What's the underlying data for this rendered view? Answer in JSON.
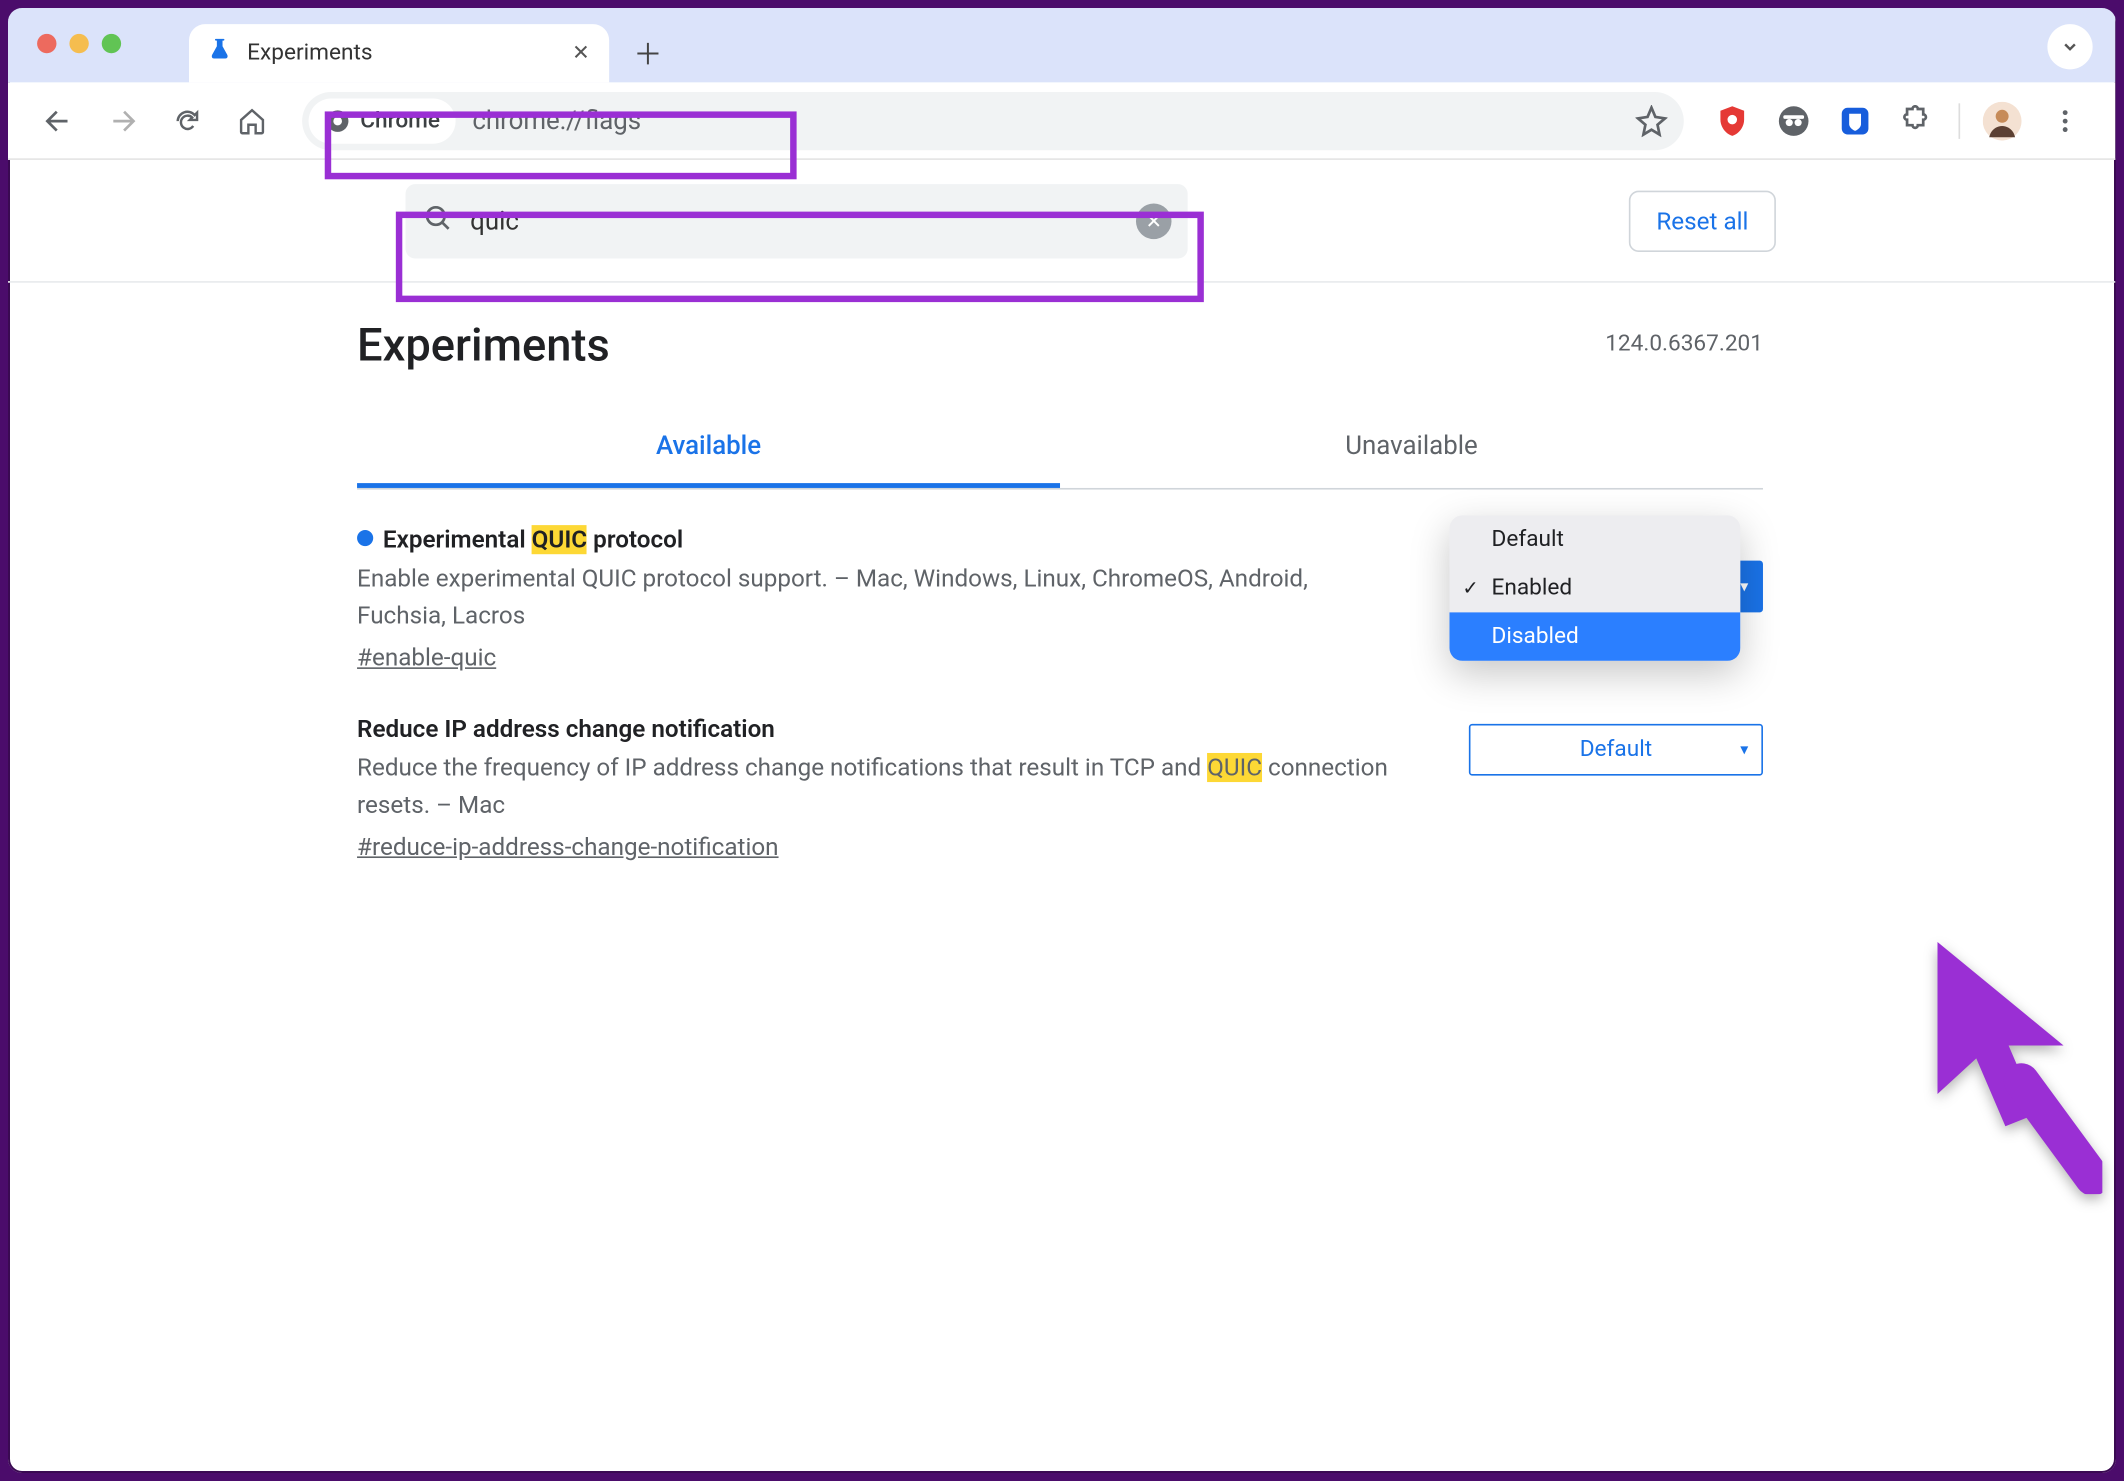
{
  "window": {
    "tab_title": "Experiments"
  },
  "toolbar": {
    "chip_label": "Chrome",
    "url": "chrome://flags"
  },
  "searchbar": {
    "value": "quic",
    "reset_label": "Reset all"
  },
  "header": {
    "title": "Experiments",
    "version": "124.0.6367.201"
  },
  "tabs": {
    "available": "Available",
    "unavailable": "Unavailable"
  },
  "flags": [
    {
      "title_pre": "Experimental ",
      "title_hl": "QUIC",
      "title_post": " protocol",
      "desc": "Enable experimental QUIC protocol support. – Mac, Windows, Linux, ChromeOS, Android, Fuchsia, Lacros",
      "hash": "#enable-quic",
      "dropdown_value": "Enabled",
      "has_dot": true,
      "menu_open": true
    },
    {
      "title_pre": "Reduce IP address change notification",
      "title_hl": "",
      "title_post": "",
      "desc_pre": "Reduce the frequency of IP address change notifications that result in TCP and ",
      "desc_hl": "QUIC",
      "desc_post": " connection resets. – Mac",
      "hash": "#reduce-ip-address-change-notification",
      "dropdown_value": "Default",
      "has_dot": false,
      "menu_open": false
    }
  ],
  "menu": {
    "default": "Default",
    "enabled": "Enabled",
    "disabled": "Disabled"
  }
}
